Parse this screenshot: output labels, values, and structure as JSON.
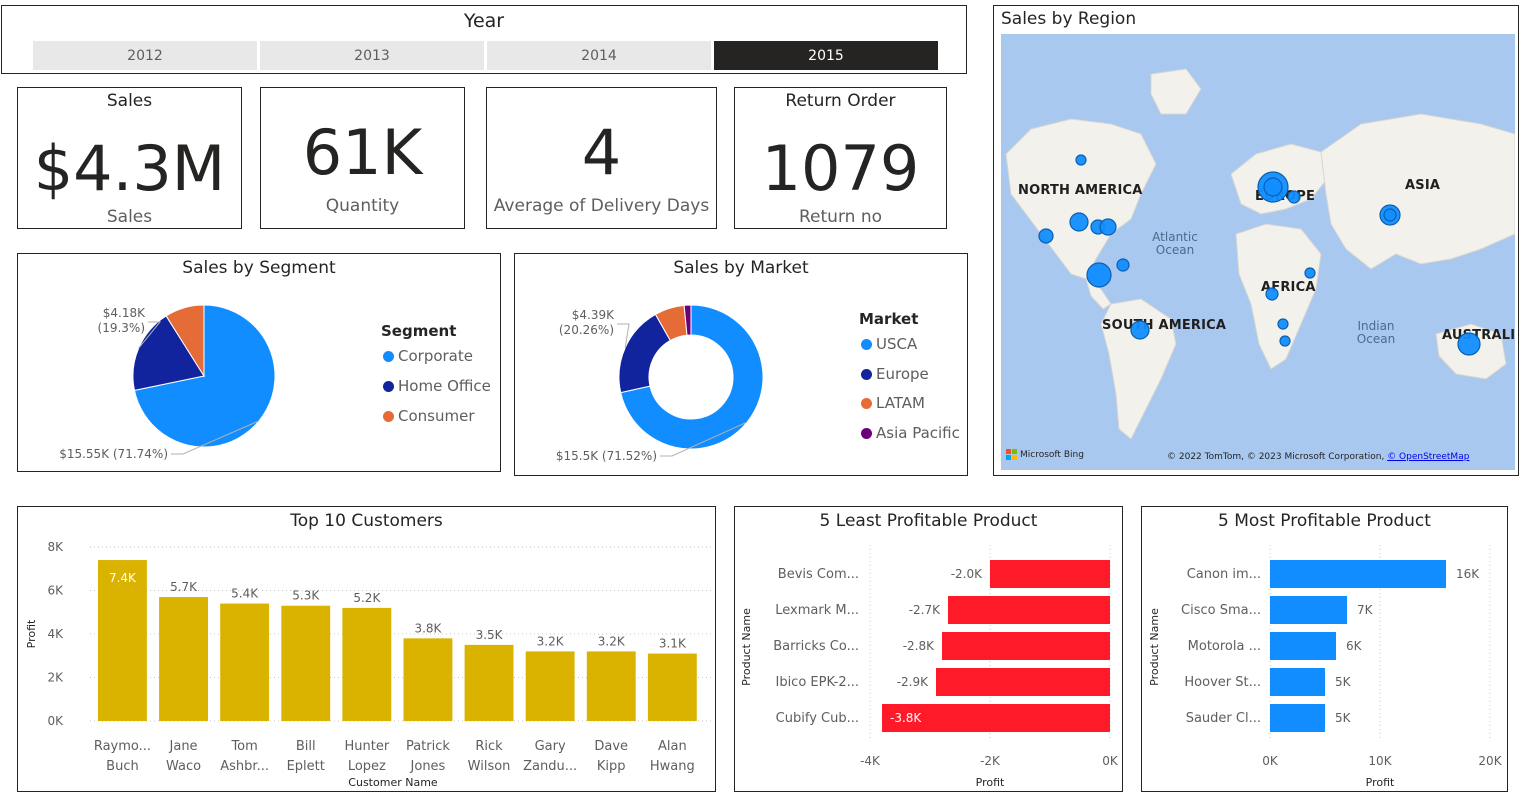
{
  "slicer": {
    "title": "Year",
    "years": [
      "2012",
      "2013",
      "2014",
      "2015"
    ],
    "selected": "2015"
  },
  "kpis": {
    "sales": {
      "header": "Sales",
      "value": "$4.3M",
      "label": "Sales"
    },
    "quantity": {
      "value": "61K",
      "label": "Quantity"
    },
    "delivery": {
      "value": "4",
      "label": "Average of Delivery Days"
    },
    "returns": {
      "header": "Return Order",
      "value": "1079",
      "label": "Return no"
    }
  },
  "colors": {
    "corporate": "#118DFF",
    "home_office": "#12239E",
    "consumer": "#E66C37",
    "asia_pacific": "#6B007B",
    "bar_gold": "#D9B300",
    "bar_red": "#FF1A2A",
    "bar_blue": "#118DFF"
  },
  "segment": {
    "title": "Sales by Segment",
    "legend_title": "Segment",
    "label_small": "$4.18K",
    "label_small_pct": "(19.3%)",
    "label_big": "$15.55K (71.74%)"
  },
  "market": {
    "title": "Sales by Market",
    "legend_title": "Market",
    "label_small": "$4.39K",
    "label_small_pct": "(20.26%)",
    "label_big": "$15.5K (71.52%)"
  },
  "map": {
    "title": "Sales by Region",
    "labels": {
      "north_america": "NORTH AMERICA",
      "europe": "EUROPE",
      "asia": "ASIA",
      "africa": "AFRICA",
      "south_america": "SOUTH AMERICA",
      "australia": "AUSTRALIA",
      "atlantic": "Atlantic Ocean",
      "indian": "Indian Ocean"
    },
    "bing": "Microsoft Bing",
    "attribution": "© 2022 TomTom, © 2023 Microsoft Corporation,",
    "osm": "© OpenStreetMap"
  },
  "top_customers": {
    "title": "Top 10 Customers",
    "xlabel": "Customer Name",
    "ylabel": "Profit"
  },
  "least_profit": {
    "title": "5 Least Profitable Product",
    "xlabel": "Profit",
    "ylabel": "Product Name"
  },
  "most_profit": {
    "title": "5 Most Profitable Product",
    "xlabel": "Profit",
    "ylabel": "Product Name"
  },
  "chart_data": [
    {
      "type": "pie",
      "title": "Sales by Segment",
      "legend_title": "Segment",
      "legend": "right",
      "categories": [
        "Corporate",
        "Home Office",
        "Consumer"
      ],
      "values": [
        15550,
        4180,
        1940
      ],
      "data_labels": [
        "$15.55K (71.74%)",
        "$4.18K (19.3%)",
        ""
      ]
    },
    {
      "type": "pie",
      "title": "Sales by Market",
      "donut": true,
      "legend_title": "Market",
      "legend": "right",
      "categories": [
        "USCA",
        "Europe",
        "LATAM",
        "Asia Pacific"
      ],
      "values": [
        15500,
        4390,
        1450,
        330
      ],
      "data_labels": [
        "$15.5K (71.52%)",
        "$4.39K (20.26%)",
        "",
        ""
      ]
    },
    {
      "type": "bar",
      "title": "Top 10 Customers",
      "xlabel": "Customer Name",
      "ylabel": "Profit",
      "categories": [
        [
          "Raymo...",
          "Buch"
        ],
        [
          "Jane",
          "Waco"
        ],
        [
          "Tom",
          "Ashbr..."
        ],
        [
          "Bill",
          "Eplett"
        ],
        [
          "Hunter",
          "Lopez"
        ],
        [
          "Patrick",
          "Jones"
        ],
        [
          "Rick",
          "Wilson"
        ],
        [
          "Gary",
          "Zandu..."
        ],
        [
          "Dave",
          "Kipp"
        ],
        [
          "Alan",
          "Hwang"
        ]
      ],
      "values": [
        7400,
        5700,
        5400,
        5300,
        5200,
        3800,
        3500,
        3200,
        3200,
        3100
      ],
      "data_labels": [
        "7.4K",
        "5.7K",
        "5.4K",
        "5.3K",
        "5.2K",
        "3.8K",
        "3.5K",
        "3.2K",
        "3.2K",
        "3.1K"
      ],
      "ylim": [
        0,
        8000
      ],
      "yticks": [
        "0K",
        "2K",
        "4K",
        "6K",
        "8K"
      ],
      "grid": true
    },
    {
      "type": "bar",
      "orientation": "horizontal",
      "title": "5 Least Profitable Product",
      "xlabel": "Profit",
      "ylabel": "Product Name",
      "categories": [
        "Bevis Com...",
        "Lexmark M...",
        "Barricks Co...",
        "Ibico EPK-2...",
        "Cubify Cub..."
      ],
      "values": [
        -2000,
        -2700,
        -2800,
        -2900,
        -3800
      ],
      "data_labels": [
        "-2.0K",
        "-2.7K",
        "-2.8K",
        "-2.9K",
        "-3.8K"
      ],
      "xlim": [
        -4000,
        0
      ],
      "xticks": [
        "-4K",
        "-2K",
        "0K"
      ],
      "grid": true
    },
    {
      "type": "bar",
      "orientation": "horizontal",
      "title": "5 Most Profitable Product",
      "xlabel": "Profit",
      "ylabel": "Product Name",
      "categories": [
        "Canon im...",
        "Cisco Sma...",
        "Motorola ...",
        "Hoover St...",
        "Sauder Cl..."
      ],
      "values": [
        16000,
        7000,
        6000,
        5000,
        5000
      ],
      "data_labels": [
        "16K",
        "7K",
        "6K",
        "5K",
        "5K"
      ],
      "xlim": [
        0,
        20000
      ],
      "xticks": [
        "0K",
        "10K",
        "20K"
      ],
      "grid": true
    }
  ]
}
